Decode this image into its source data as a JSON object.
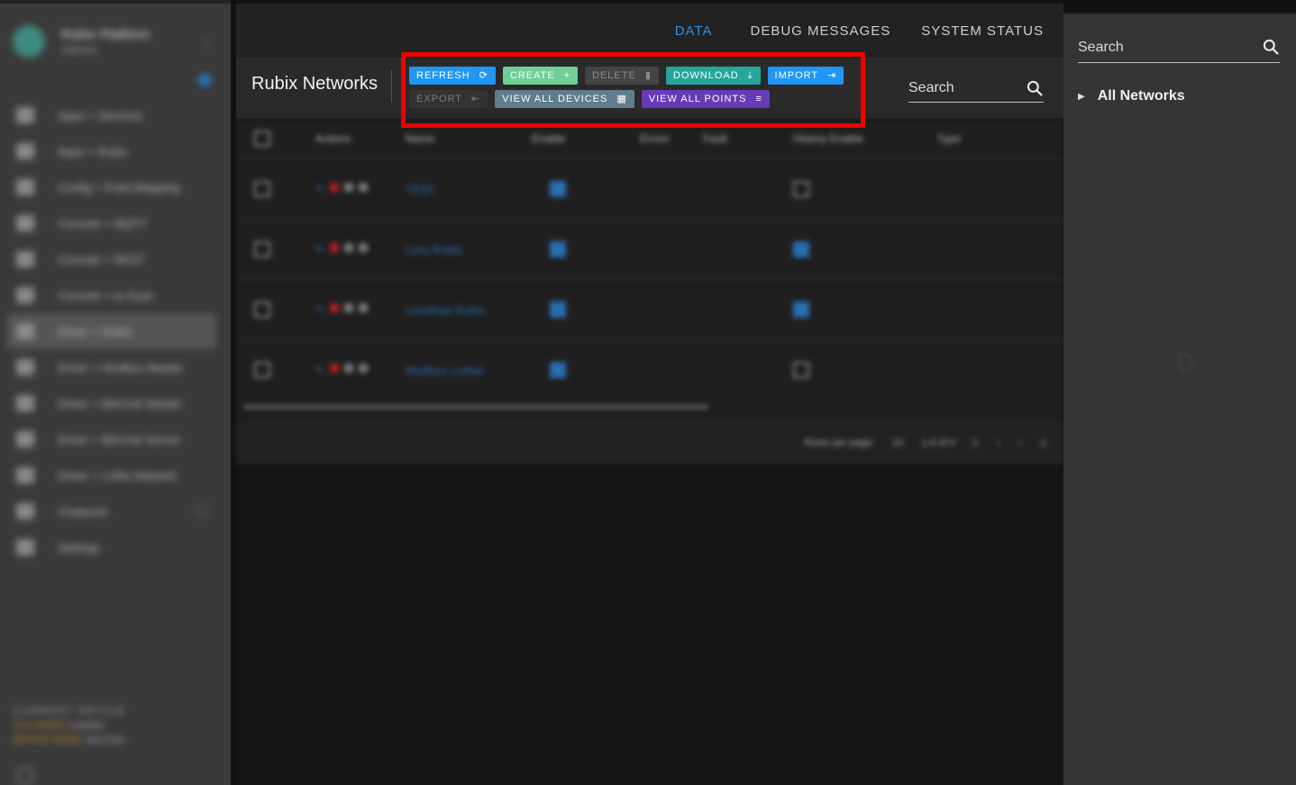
{
  "sidebar": {
    "brand_title": "Rubix Platform",
    "brand_subtitle": "Optimize",
    "nav": [
      {
        "label": "Apps > Services"
      },
      {
        "label": "Apps > Rubix"
      },
      {
        "label": "Config > Point Mapping"
      },
      {
        "label": "Console > MQTT"
      },
      {
        "label": "Console > REST"
      },
      {
        "label": "Console > lo-Scan"
      },
      {
        "label": "Driver > Rubix",
        "active": true
      },
      {
        "label": "Driver > Modbus Master"
      },
      {
        "label": "Driver > BACnet Master"
      },
      {
        "label": "Driver > BACnet Server"
      },
      {
        "label": "Driver > LoRa Network"
      },
      {
        "label": "Chatwork"
      },
      {
        "label": "Settings"
      }
    ],
    "device_heading": "CURRENT DEVICE",
    "device_label_1": "SYS MODE",
    "device_value_1": "installed",
    "device_label_2": "DEVICE NAME",
    "device_value_2": "client box"
  },
  "tabs": [
    {
      "label": "DATA",
      "active": true
    },
    {
      "label": "DEBUG MESSAGES"
    },
    {
      "label": "SYSTEM STATUS"
    }
  ],
  "toolbar": {
    "title": "Rubix Networks",
    "refresh": "REFRESH",
    "create": "CREATE",
    "delete": "DELETE",
    "download": "DOWNLOAD",
    "import": "IMPORT",
    "export": "EXPORT",
    "view_all_devices": "VIEW ALL DEVICES",
    "view_all_points": "VIEW ALL POINTS",
    "search_placeholder": "Search"
  },
  "table": {
    "headers": [
      "Actions",
      "Name",
      "Enable",
      "Errors",
      "Fault",
      "History Enable",
      "Type"
    ],
    "rows": [
      {
        "name": "TEST",
        "enable": true,
        "history": false
      },
      {
        "name": "Lora Rubix",
        "enable": true,
        "history": true
      },
      {
        "name": "LoraRaw Rubix",
        "enable": true,
        "history": true
      },
      {
        "name": "Modbus Lorber",
        "enable": true,
        "history": false
      }
    ],
    "rows_per_page_label": "Rows per page:",
    "rows_per_page": "10",
    "range": "1-4 of 4"
  },
  "right_panel": {
    "search_placeholder": "Search",
    "tree_root": "All Networks"
  },
  "colors": {
    "accent": "#2196f3",
    "create": "#6fcf97",
    "download": "#26a69a",
    "devices": "#607d8b",
    "points": "#673ab7",
    "highlight": "#ef0000"
  }
}
